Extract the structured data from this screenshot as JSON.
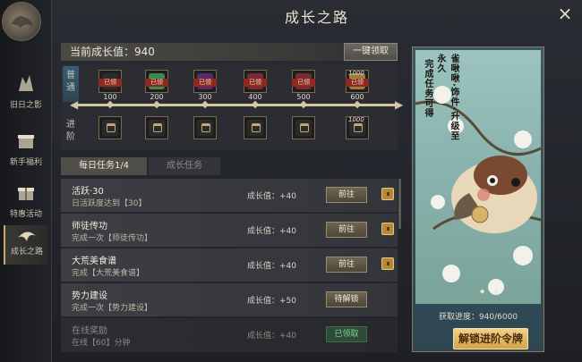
{
  "title": "成长之路",
  "close_label": "×",
  "sidebar": {
    "items": [
      {
        "label": "旧日之影",
        "icon": "shadow-icon"
      },
      {
        "label": "新手福利",
        "icon": "gift-sparkle-icon"
      },
      {
        "label": "特惠活动",
        "icon": "gift-box-icon"
      },
      {
        "label": "成长之路",
        "icon": "tree-icon"
      }
    ]
  },
  "growth": {
    "label": "当前成长值：940",
    "claim_all": "一键领取"
  },
  "track": {
    "normal_label": "普通",
    "advanced_label": "进阶",
    "levels": [
      "100",
      "200",
      "300",
      "400",
      "500",
      "600"
    ],
    "claimed_tag": "已领",
    "normal_rewards": [
      {
        "tag": "已领",
        "qty": "",
        "color": "#2b2b2d"
      },
      {
        "tag": "已领",
        "qty": "",
        "color": "#3d8a4d"
      },
      {
        "tag": "已领",
        "qty": "",
        "color": "#5a2b6a"
      },
      {
        "tag": "已领",
        "qty": "",
        "color": "#7a2a2f"
      },
      {
        "tag": "已领",
        "qty": "",
        "color": "#7a2a2f"
      },
      {
        "tag": "已领",
        "qty": "",
        "top": "1000",
        "color": "#a07a3a"
      }
    ],
    "advanced_top_qty": "1000",
    "progress_fraction": 1.0
  },
  "tabs": {
    "daily": "每日任务1/4",
    "growth": "成长任务"
  },
  "tasks": [
    {
      "name": "活跃·30",
      "desc": "日活跃度达到【30】",
      "growth": "成长值：+40",
      "button": "前往",
      "dim": false,
      "chest": true
    },
    {
      "name": "师徒传功",
      "desc": "完成一次【师徒传功】",
      "growth": "成长值：+40",
      "button": "前往",
      "dim": false,
      "chest": true
    },
    {
      "name": "大荒美食谱",
      "desc": "完成【大荒美食谱】",
      "growth": "成长值：+40",
      "button": "前往",
      "dim": false,
      "chest": true
    },
    {
      "name": "势力建设",
      "desc": "完成一次【势力建设】",
      "growth": "成长值：+50",
      "button": "待解锁",
      "dim": false,
      "chest": false
    },
    {
      "name": "在线奖励",
      "desc": "在线【60】分钟",
      "growth": "成长值：+40",
      "button": "已领取",
      "dim": true,
      "chest": false
    }
  ],
  "panel": {
    "vertical_main": "雀啾啾·饰件·升级至永久",
    "vertical_side": "完成任务可得",
    "pager": "◆ ◆",
    "progress": "获取进度：940/6000",
    "unlock": "解锁进阶令牌"
  }
}
